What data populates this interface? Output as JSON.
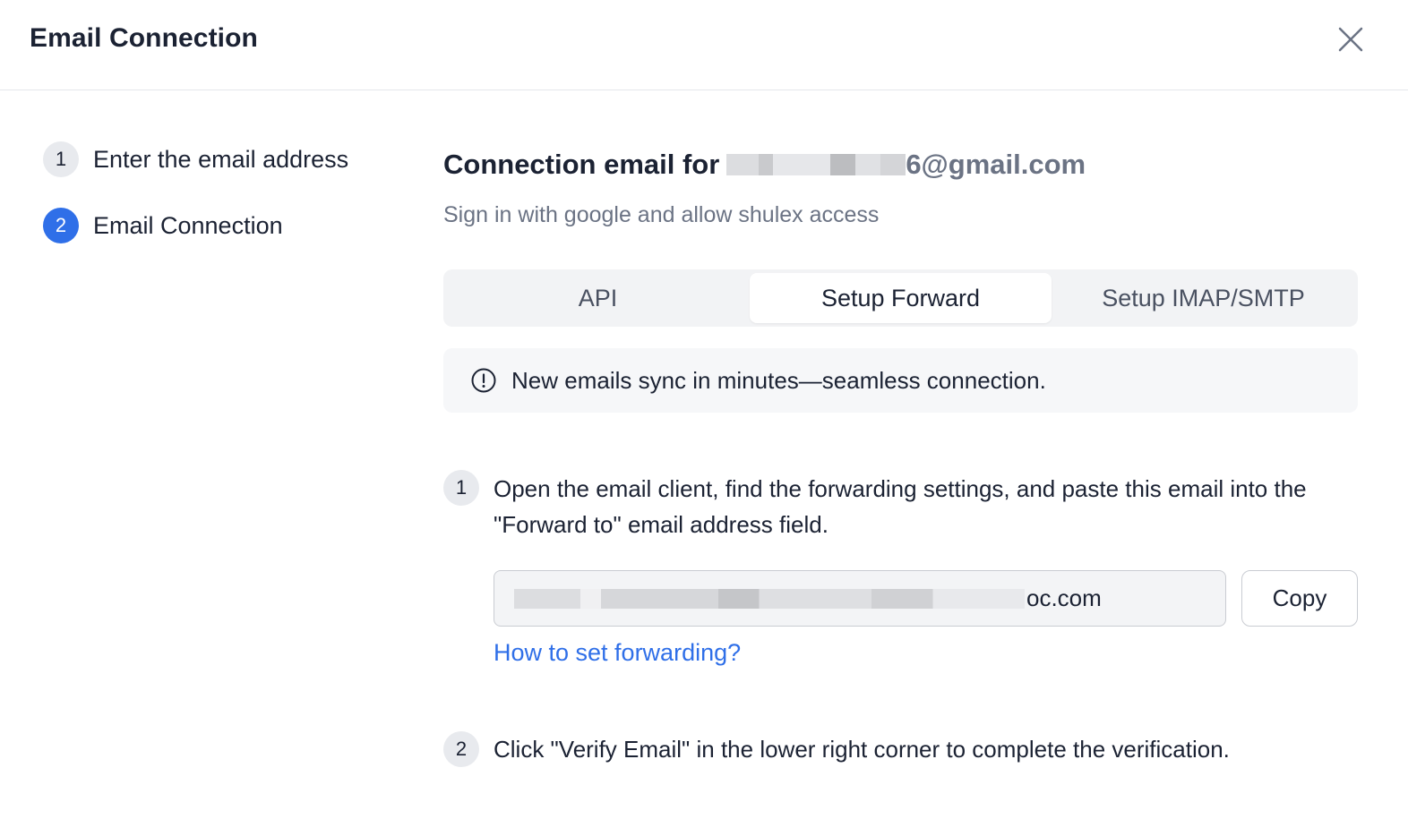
{
  "header": {
    "title": "Email Connection"
  },
  "stepper": [
    {
      "number": "1",
      "label": "Enter the email address",
      "state": "done"
    },
    {
      "number": "2",
      "label": "Email Connection",
      "state": "active"
    }
  ],
  "main": {
    "title_prefix": "Connection email for",
    "title_email_visible": "6@gmail.com",
    "subtitle": "Sign in with google and allow shulex access",
    "tabs": [
      {
        "label": "API",
        "selected": false
      },
      {
        "label": "Setup Forward",
        "selected": true
      },
      {
        "label": "Setup IMAP/SMTP",
        "selected": false
      }
    ],
    "alert": {
      "icon": "info-circle-icon",
      "text": "New emails sync in minutes—seamless connection."
    },
    "instructions": [
      {
        "number": "1",
        "line1": "Open the email client, find the forwarding settings, and paste this email into the",
        "line2": "\"Forward to\" email address field."
      },
      {
        "number": "2",
        "line1": "Click \"Verify Email\" in the lower right corner to complete the verification."
      }
    ],
    "forward_field": {
      "value_visible": "oc.com"
    },
    "copy_label": "Copy",
    "help_link": "How to set forwarding?"
  },
  "colors": {
    "accent": "#2f6fe8",
    "text": "#1b2233",
    "muted": "#6b7384",
    "surface": "#f2f3f5"
  }
}
